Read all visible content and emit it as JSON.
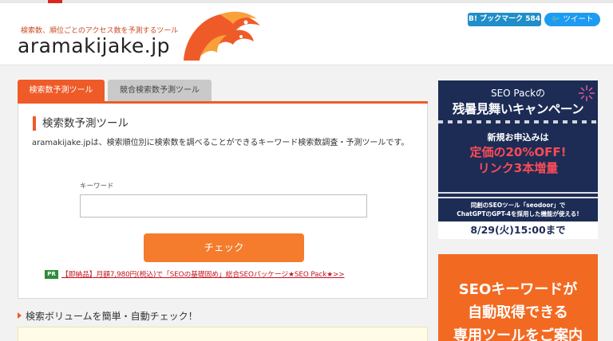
{
  "header": {
    "tagline": "検索数、順位ごとのアクセス数を予測するツール",
    "logo_text": "aramakijake.jp",
    "bookmark_label": "B! ブックマーク 584",
    "tweet_label": "🐦 ツイート"
  },
  "tabs": [
    {
      "label": "検索数予測ツール"
    },
    {
      "label": "競合検索数予測ツール"
    }
  ],
  "tool": {
    "title": "検索数予測ツール",
    "description": "aramakijake.jpは、検索順位別に検索数を調べることができるキーワード検索数調査・予測ツールです。",
    "keyword_label": "キーワード",
    "keyword_value": "",
    "check_button": "チェック",
    "pr_badge": "PR",
    "pr_link": "【即納品】月額7,980円(税込)で「SEOの基礎固め」総合SEOパッケージ★SEO Pack★>>"
  },
  "section": {
    "heading": "検索ボリュームを簡単・自動チェック！"
  },
  "banner_seopack": {
    "line1": "SEO Packの",
    "line2": "残暑見舞いキャンペーン",
    "line3": "新規お申込みは",
    "line4": "定価の20%OFF!",
    "line5": "リンク3本増量",
    "line6": "同創のSEOツール「seodoor」で",
    "line7": "ChatGPTのGPT-4を採用した機能が使える!",
    "date": "8/29(火)15:00まで"
  },
  "banner_keyword": {
    "line1": "SEOキーワードが",
    "line2": "自動取得できる",
    "line3": "専用ツールをご案内"
  },
  "colors": {
    "accent": "#ef5b28",
    "button": "#f47c2c",
    "pr_green": "#2e8b3a",
    "banner_navy": "#1c2c55",
    "banner_orange": "#f26a21"
  }
}
